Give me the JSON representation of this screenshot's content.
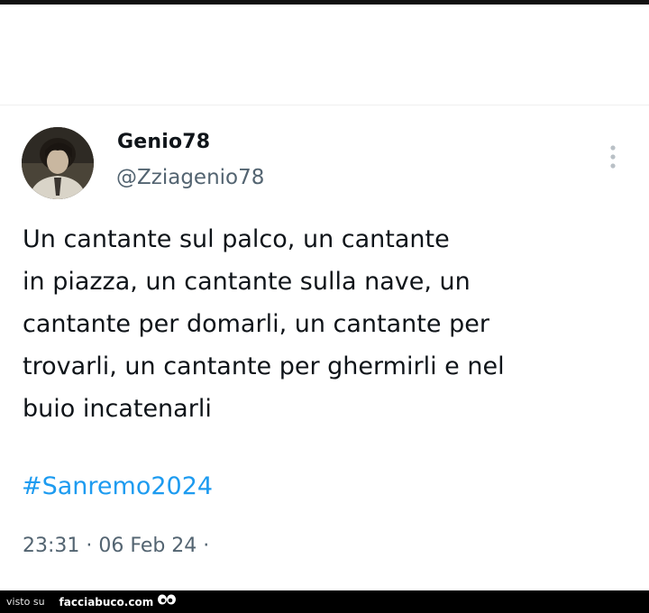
{
  "tweet": {
    "author": {
      "display_name": "Genio78",
      "handle": "@Zziagenio78"
    },
    "more_icon": "more-vertical-icon",
    "text_lines": [
      "Un cantante sul palco, un cantante",
      "in piazza, un cantante sulla nave, un",
      "cantante per domarli, un cantante per",
      "trovarli, un cantante per ghermirli e nel",
      "buio incatenarli"
    ],
    "hashtag": "#Sanremo2024",
    "timestamp": "23:31 · 06 Feb 24 ·"
  },
  "watermark": {
    "prefix": "visto su",
    "site": "facciabuco.com",
    "logo_icon": "eyes-icon"
  },
  "colors": {
    "text": "#0f1419",
    "secondary": "#536471",
    "link": "#1d9bf0",
    "footer_bg": "#000000"
  }
}
